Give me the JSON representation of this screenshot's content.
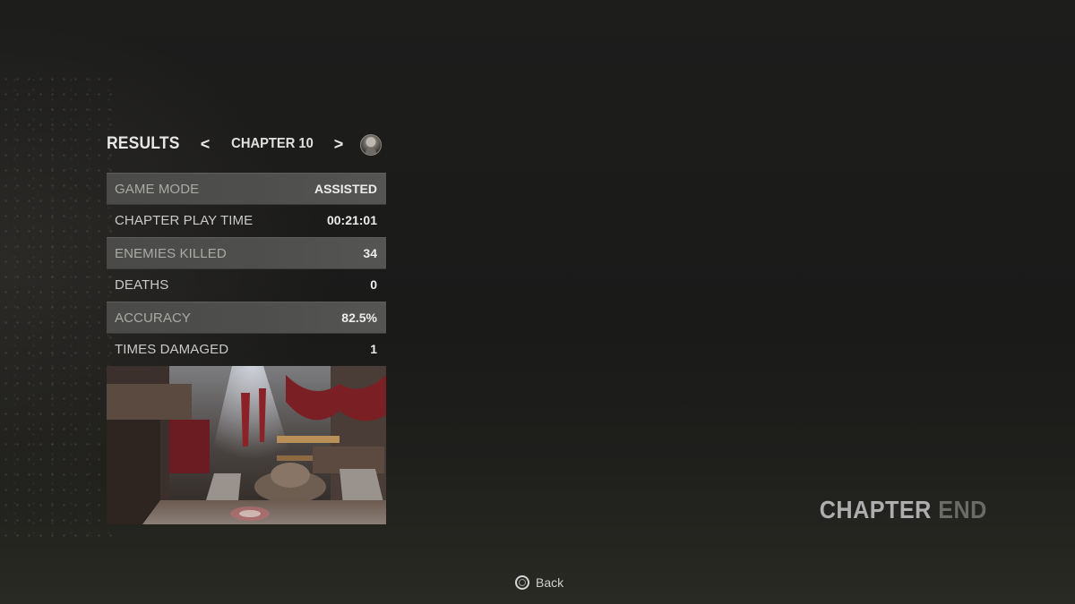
{
  "header": {
    "title": "RESULTS",
    "prev_arrow": "<",
    "chapter_label": "CHAPTER 10",
    "next_arrow": ">"
  },
  "stats": [
    {
      "label": "GAME MODE",
      "value": "ASSISTED"
    },
    {
      "label": "CHAPTER PLAY TIME",
      "value": "00:21:01"
    },
    {
      "label": "ENEMIES KILLED",
      "value": "34"
    },
    {
      "label": "DEATHS",
      "value": "0"
    },
    {
      "label": "ACCURACY",
      "value": "82.5%"
    },
    {
      "label": "TIMES DAMAGED",
      "value": "1"
    }
  ],
  "chapter_end": {
    "word1": "CHAPTER",
    "word2": "END"
  },
  "footer": {
    "button_icon": "circle-button-icon",
    "back_label": "Back"
  },
  "colors": {
    "shaded_row": "#4f4f4d",
    "accent_text": "#ececec",
    "muted_text": "#6a6a68"
  }
}
